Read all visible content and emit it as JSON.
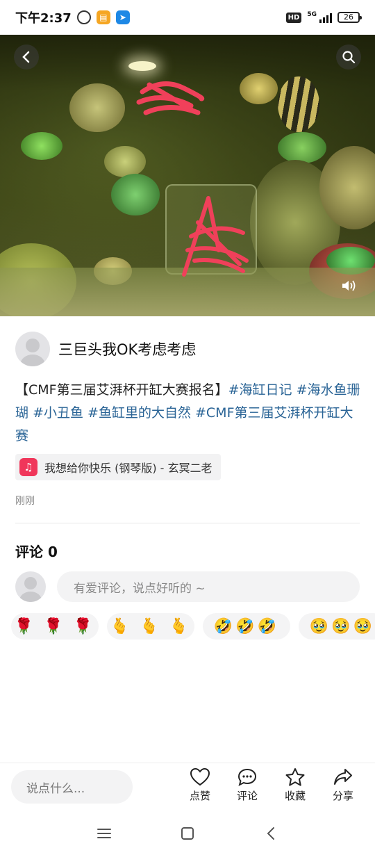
{
  "status_bar": {
    "time": "下午2:37",
    "hd": "HD",
    "network": "5G",
    "battery": "26"
  },
  "media": {
    "back_icon": "back-arrow-icon",
    "search_icon": "search-icon",
    "sound_icon": "speaker-icon"
  },
  "author": {
    "name": "三巨头我OK考虑考虑"
  },
  "post": {
    "prefix": "【CMF第三届艾湃杯开缸大赛报名】",
    "hashtags": [
      "#海缸日记",
      "#海水鱼珊瑚",
      "#小丑鱼",
      "#鱼缸里的大自然",
      "#CMF第三届艾湃杯开缸大赛"
    ],
    "music": "我想给你快乐 (钢琴版) - 玄冥二老",
    "time": "刚刚"
  },
  "comments": {
    "title": "评论",
    "count": "0",
    "placeholder": "有爱评论，说点好听的 ~",
    "quick_emojis": [
      "🌹 🌹 🌹",
      "🫰 🫰 🫰",
      "🤣🤣🤣",
      "🥹🥹🥹"
    ]
  },
  "bottom_bar": {
    "input_placeholder": "说点什么...",
    "like": "点赞",
    "comment": "评论",
    "favorite": "收藏",
    "share": "分享"
  },
  "colors": {
    "hashtag": "#2a6496",
    "music_icon": "#f0365a"
  }
}
